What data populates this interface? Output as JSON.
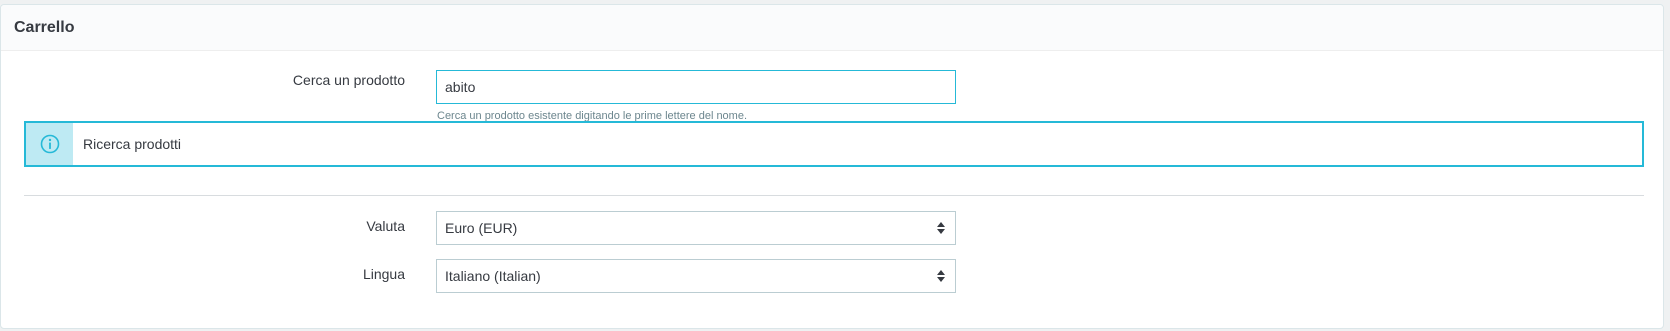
{
  "panel": {
    "title": "Carrello"
  },
  "product_search": {
    "label": "Cerca un prodotto",
    "value": "abito",
    "help": "Cerca un prodotto esistente digitando le prime lettere del nome."
  },
  "alert": {
    "icon": "info-circle-icon",
    "text": "Ricerca prodotti",
    "accent_color": "#25b9d7"
  },
  "currency": {
    "label": "Valuta",
    "selected": "Euro (EUR)"
  },
  "language": {
    "label": "Lingua",
    "selected": "Italiano (Italian)"
  }
}
